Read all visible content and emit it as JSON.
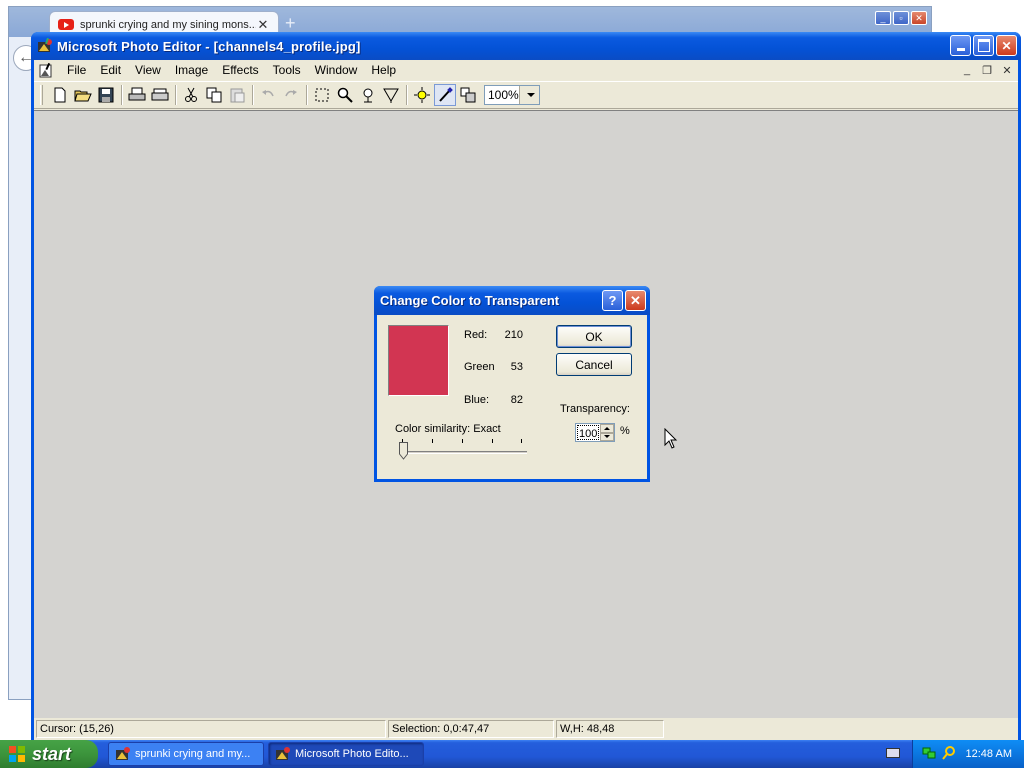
{
  "browser": {
    "tab_title": "sprunki crying and my sining mons...",
    "close_glyph": "✕",
    "newtab_glyph": "+",
    "back_glyph": "←"
  },
  "app": {
    "title": "Microsoft Photo Editor - [channels4_profile.jpg]",
    "menus": [
      "File",
      "Edit",
      "View",
      "Image",
      "Effects",
      "Tools",
      "Window",
      "Help"
    ],
    "zoom": "100%",
    "status": {
      "cursor": "Cursor: (15,26)",
      "selection": "Selection: 0,0:47,47",
      "size": "W,H: 48,48"
    }
  },
  "dialog": {
    "title": "Change Color to Transparent",
    "help_glyph": "?",
    "close_glyph": "✕",
    "swatch_color": "#d23552",
    "red_label": "Red:",
    "red_value": "210",
    "green_label": "Green",
    "green_value": "53",
    "blue_label": "Blue:",
    "blue_value": "82",
    "ok_label": "OK",
    "cancel_label": "Cancel",
    "transparency_label": "Transparency:",
    "transparency_value": "100",
    "percent": "%",
    "similarity_label": "Color similarity:  Exact"
  },
  "taskbar": {
    "start_label": "start",
    "tasks": [
      {
        "label": "sprunki crying and my..."
      },
      {
        "label": "Microsoft Photo Edito..."
      }
    ],
    "clock": "12:48 AM"
  },
  "colors": {
    "xp_blue": "#0054e3",
    "dialog_face": "#ece9d8",
    "workspace": "#d4d3d0"
  }
}
